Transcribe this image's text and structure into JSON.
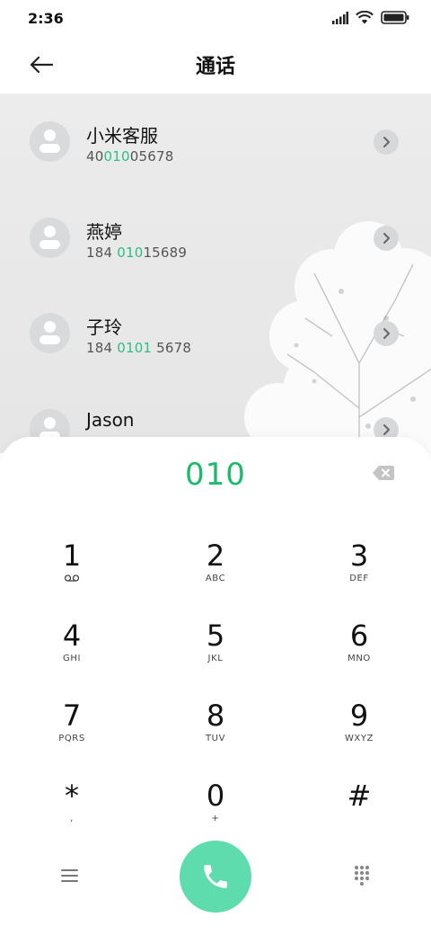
{
  "status_bar": {
    "time": "2:36"
  },
  "header": {
    "title": "通话"
  },
  "contacts": [
    {
      "name": "小米客服",
      "number_pre": "40",
      "number_hl": "010",
      "number_post": "05678"
    },
    {
      "name": "燕婷",
      "number_pre": "184 ",
      "number_hl": "010",
      "number_post": "15689"
    },
    {
      "name": "子玲",
      "number_pre": "184 ",
      "number_hl": "0101",
      "number_post": " 5678"
    },
    {
      "name": "Jason"
    }
  ],
  "dialer": {
    "input": "010",
    "keys": [
      {
        "digit": "1",
        "letters": ""
      },
      {
        "digit": "2",
        "letters": "ABC"
      },
      {
        "digit": "3",
        "letters": "DEF"
      },
      {
        "digit": "4",
        "letters": "GHI"
      },
      {
        "digit": "5",
        "letters": "JKL"
      },
      {
        "digit": "6",
        "letters": "MNO"
      },
      {
        "digit": "7",
        "letters": "PQRS"
      },
      {
        "digit": "8",
        "letters": "TUV"
      },
      {
        "digit": "9",
        "letters": "WXYZ"
      },
      {
        "digit": "*",
        "letters": ","
      },
      {
        "digit": "0",
        "letters": "+"
      },
      {
        "digit": "#",
        "letters": ""
      }
    ]
  },
  "colors": {
    "accent": "#1fb96b",
    "call_button": "#5edcae",
    "highlight": "#2dbf86"
  }
}
